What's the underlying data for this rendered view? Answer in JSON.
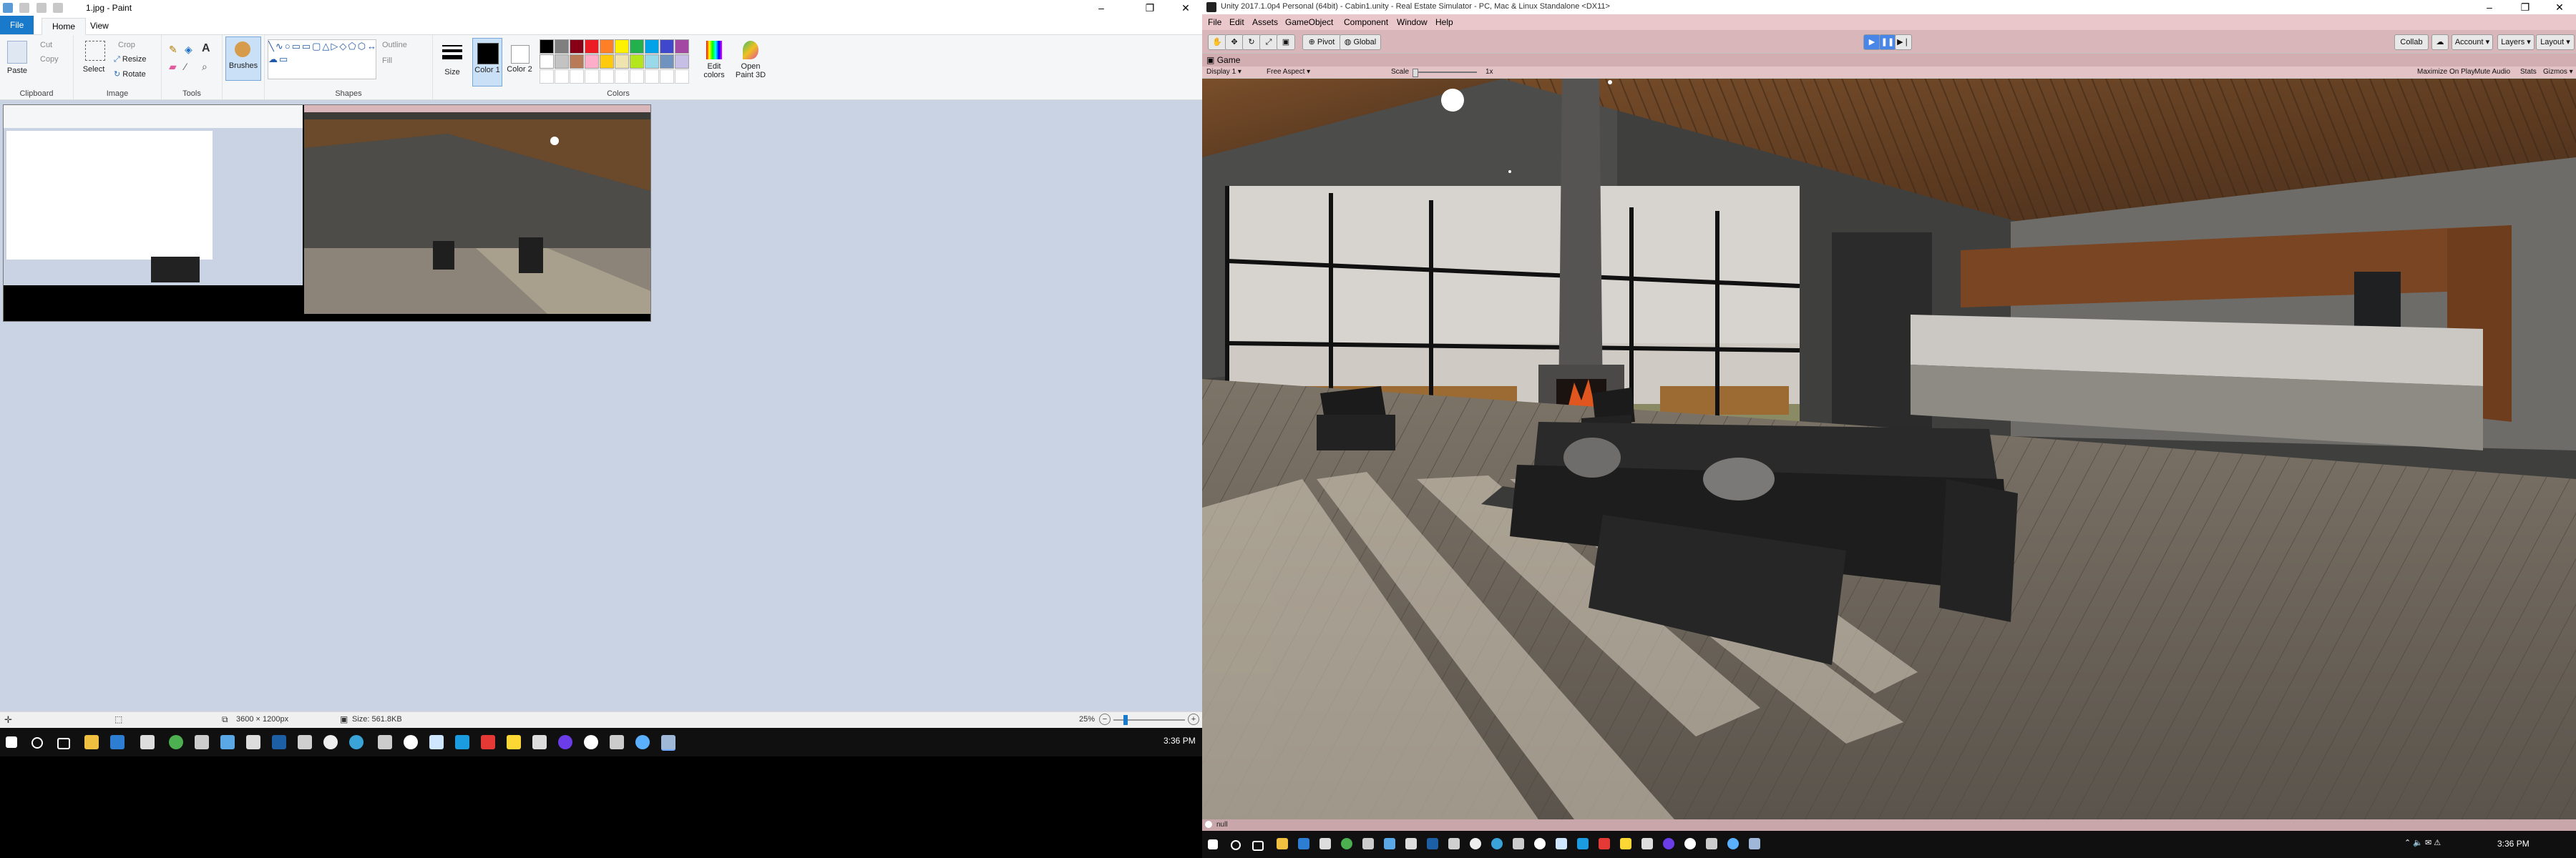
{
  "paint": {
    "title": "1.jpg - Paint",
    "tabs": {
      "file": "File",
      "home": "Home",
      "view": "View"
    },
    "clipboard": {
      "paste": "Paste",
      "cut": "Cut",
      "copy": "Copy",
      "label": "Clipboard"
    },
    "image": {
      "select": "Select",
      "crop": "Crop",
      "resize": "Resize",
      "rotate": "Rotate",
      "label": "Image"
    },
    "tools": {
      "label": "Tools"
    },
    "brushes": {
      "label": "Brushes"
    },
    "shapes": {
      "outline": "Outline",
      "fill": "Fill",
      "label": "Shapes"
    },
    "size": {
      "label": "Size"
    },
    "color1": {
      "label": "Color 1"
    },
    "color2": {
      "label": "Color 2"
    },
    "colors": {
      "label": "Colors",
      "edit": "Edit colors",
      "paint3d": "Open Paint 3D"
    },
    "palette": [
      "#000000",
      "#7f7f7f",
      "#880015",
      "#ed1c24",
      "#ff7f27",
      "#fff200",
      "#22b14c",
      "#00a2e8",
      "#3f48cc",
      "#a349a4",
      "#ffffff",
      "#c3c3c3",
      "#b97a57",
      "#ffaec9",
      "#ffc90e",
      "#efe4b0",
      "#b5e61d",
      "#99d9ea",
      "#7092be",
      "#c8bfe7"
    ],
    "status": {
      "dimensions": "3600 × 1200px",
      "size": "Size: 561.8KB",
      "zoom": "25%"
    }
  },
  "taskbar_left": {
    "time": "3:36 PM"
  },
  "taskbar_right": {
    "time": "3:36 PM"
  },
  "unity": {
    "title": "Unity 2017.1.0p4 Personal (64bit) - Cabin1.unity - Real Estate Simulator - PC, Mac & Linux Standalone <DX11>",
    "menu": [
      "File",
      "Edit",
      "Assets",
      "GameObject",
      "Component",
      "Window",
      "Help"
    ],
    "toolbar": {
      "pivot": "Pivot",
      "global": "Global",
      "collab": "Collab",
      "account": "Account",
      "layers": "Layers",
      "layout": "Layout"
    },
    "game_tab": "Game",
    "game_bar": {
      "display": "Display 1",
      "aspect": "Free Aspect",
      "scale_label": "Scale",
      "scale_value": "1x",
      "maximize": "Maximize On Play",
      "mute": "Mute Audio",
      "stats": "Stats",
      "gizmos": "Gizmos"
    },
    "status": "null"
  }
}
